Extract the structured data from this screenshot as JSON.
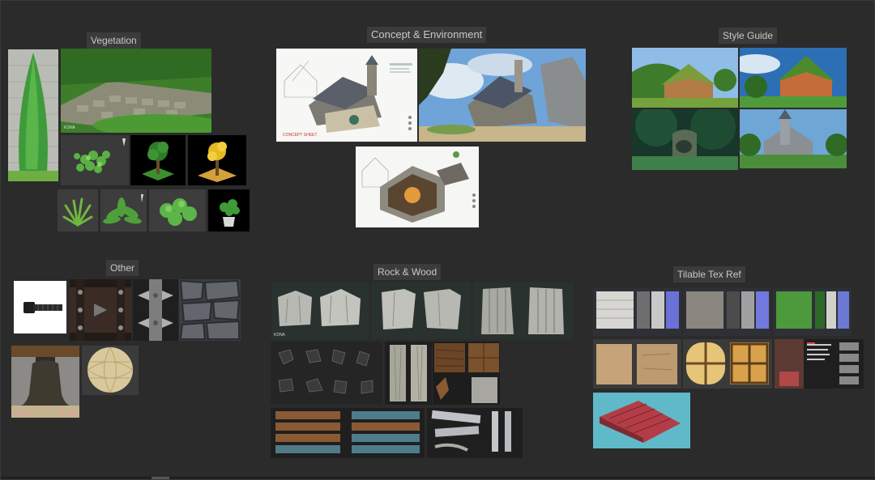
{
  "groups": {
    "vegetation": "Vegetation",
    "concept": "Concept & Environment",
    "style_guide": "Style Guide",
    "other": "Other",
    "rock_wood": "Rock & Wood",
    "tilable": "Tilable Tex Ref"
  },
  "images": {
    "cypress": "cypress-tree-image",
    "grass_path": "grass-path-image",
    "ivy": "ivy-leaves-image",
    "green_tree": "green-tree-image",
    "yellow_tree": "yellow-tree-image",
    "fern": "fern-image",
    "broadleaf": "broadleaf-plant-image",
    "round_leaves": "round-leaves-image",
    "potted_plant": "potted-plant-image",
    "house_concept": "house-concept-sheet-image",
    "house_painting": "house-painting-image",
    "house_cutaway": "house-cutaway-sheet-image",
    "sg_village": "style-guide-village-image",
    "sg_cottage": "style-guide-cottage-image",
    "sg_forest": "style-guide-forest-image",
    "sg_castle": "style-guide-castle-image",
    "bolt": "bolt-image",
    "leather_studs": "leather-studs-image",
    "metal_spikes": "metal-spikes-image",
    "stone_wall": "stone-wall-image",
    "bell": "liberty-bell-image",
    "wicker_ball": "wicker-ball-image",
    "rock_cliffs": "rock-cliffs-image",
    "rock_pillars": "rock-pillars-image",
    "rock_columns": "rock-columns-image",
    "pebbles": "pebbles-image",
    "planks": "wood-planks-image",
    "wood_textures": "wood-textures-image",
    "wood_boards": "wood-boards-image",
    "white_planks": "white-planks-image",
    "tex_brick": "brick-texture-image",
    "tex_rock": "rock-texture-image",
    "tex_moss": "moss-texture-image",
    "tex_sandstone": "sandstone-texture-image",
    "tex_window": "window-texture-image",
    "tex_sheet": "texture-sheet-image",
    "roof": "roof-tiles-image"
  },
  "captions": {
    "watermark": "KDNA",
    "sheet_text": "CONCEPT SHEET"
  },
  "colors": {
    "background": "#2b2b2b",
    "label_bg": "#3b3b3b",
    "label_text": "#c8c8c8"
  }
}
